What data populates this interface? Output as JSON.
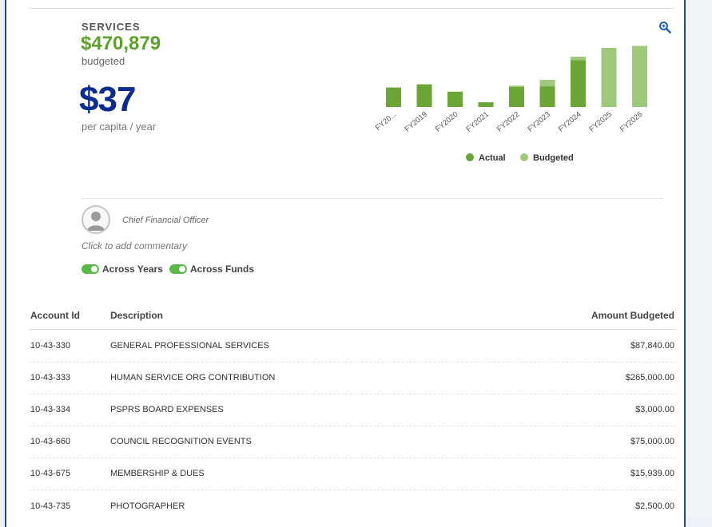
{
  "summary": {
    "category": "SERVICES",
    "budgeted_amount": "$470,879",
    "budgeted_label": "budgeted",
    "per_capita": "$37",
    "per_capita_label": "per capita / year"
  },
  "icons": {
    "zoom": "zoom-in-icon",
    "avatar": "user-avatar-icon"
  },
  "colors": {
    "accent_green": "#5aa22a",
    "navy": "#0a2b8f",
    "actual": "#6aa535",
    "budgeted": "#9fc97a"
  },
  "chart_data": {
    "type": "bar",
    "categories": [
      "FY20...",
      "FY2019",
      "FY2020",
      "FY2021",
      "FY2022",
      "FY2023",
      "FY2024",
      "FY2025",
      "FY2026"
    ],
    "series": [
      {
        "name": "Actual",
        "values": [
          125,
          145,
          98,
          30,
          127,
          132,
          300,
          0,
          0
        ]
      },
      {
        "name": "Budgeted",
        "values": [
          125,
          145,
          98,
          30,
          137,
          174,
          323,
          380,
          392
        ]
      }
    ],
    "legend": [
      "Actual",
      "Budgeted"
    ],
    "legend_position": "bottom",
    "grid": false
  },
  "commentary": {
    "author": "Chief Financial Officer",
    "placeholder": "Click to add commentary"
  },
  "toggles": [
    {
      "label": "Across Years",
      "on": true
    },
    {
      "label": "Across Funds",
      "on": true
    }
  ],
  "table": {
    "headers": {
      "account": "Account Id",
      "description": "Description",
      "amount": "Amount Budgeted"
    },
    "rows": [
      {
        "account": "10-43-330",
        "description": "GENERAL PROFESSIONAL SERVICES",
        "amount": "$87,840.00"
      },
      {
        "account": "10-43-333",
        "description": "HUMAN SERVICE ORG CONTRIBUTION",
        "amount": "$265,000.00"
      },
      {
        "account": "10-43-334",
        "description": "PSPRS BOARD EXPENSES",
        "amount": "$3,000.00"
      },
      {
        "account": "10-43-660",
        "description": "COUNCIL RECOGNITION EVENTS",
        "amount": "$75,000.00"
      },
      {
        "account": "10-43-675",
        "description": "MEMBERSHIP & DUES",
        "amount": "$15,939.00"
      },
      {
        "account": "10-43-735",
        "description": "PHOTOGRAPHER",
        "amount": "$2,500.00"
      }
    ]
  }
}
